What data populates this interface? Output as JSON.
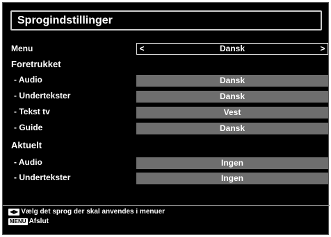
{
  "title": "Sprogindstillinger",
  "menu": {
    "label": "Menu",
    "value": "Dansk"
  },
  "preferred": {
    "heading": "Foretrukket",
    "rows": [
      {
        "label": "- Audio",
        "value": "Dansk"
      },
      {
        "label": "- Undertekster",
        "value": "Dansk"
      },
      {
        "label": "- Tekst tv",
        "value": "Vest"
      },
      {
        "label": "- Guide",
        "value": "Dansk"
      }
    ]
  },
  "current": {
    "heading": "Aktuelt",
    "rows": [
      {
        "label": "- Audio",
        "value": "Ingen"
      },
      {
        "label": "- Undertekster",
        "value": "Ingen"
      }
    ]
  },
  "footer": {
    "arrows_key": "◀▶",
    "arrows_text": "Vælg det sprog der skal anvendes i menuer",
    "menu_key": "MENU",
    "menu_text": "Afslut"
  },
  "colors": {
    "background": "#000000",
    "bar": "#6e6e6e",
    "text": "#ffffff"
  }
}
